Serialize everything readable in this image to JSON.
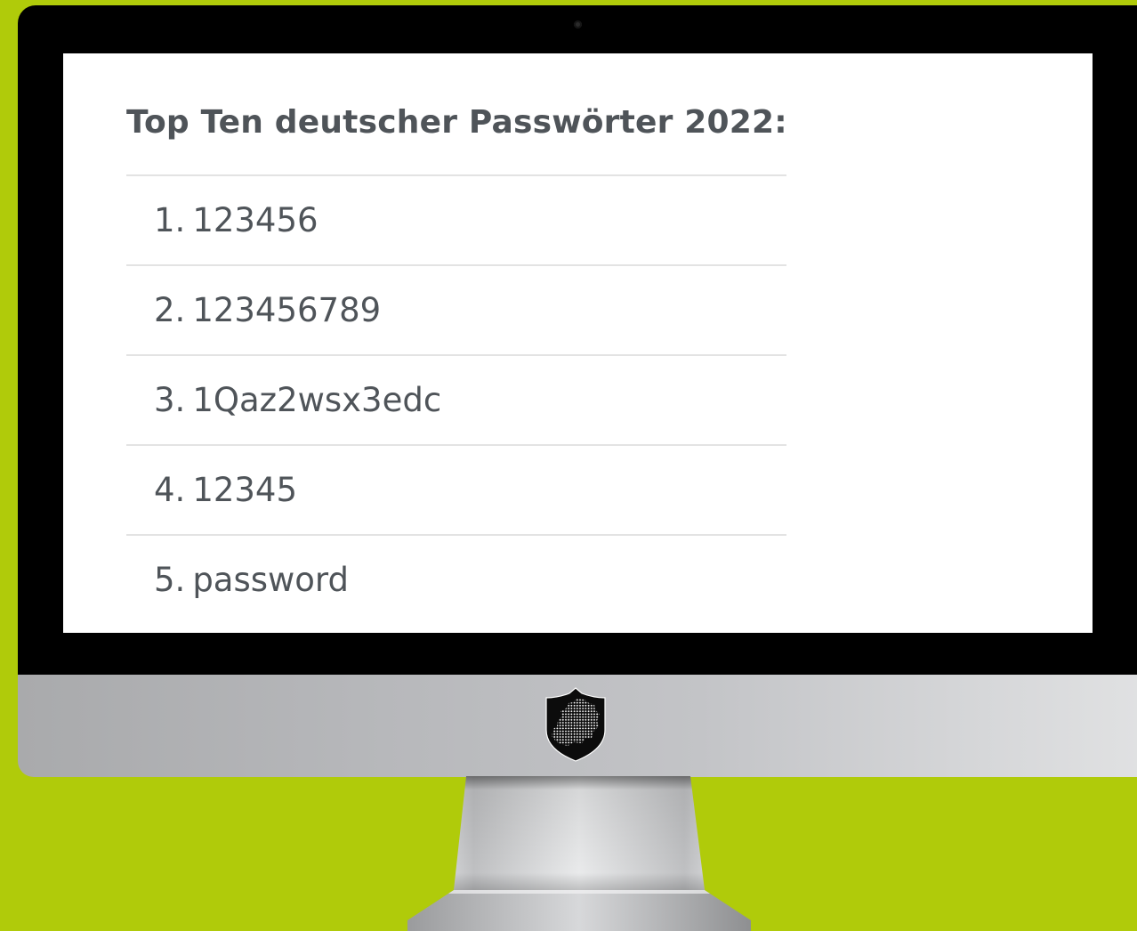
{
  "screen": {
    "title": "Top Ten deutscher Passwörter 2022:",
    "passwords": [
      {
        "rank": "1.",
        "value": "123456"
      },
      {
        "rank": "2.",
        "value": "123456789"
      },
      {
        "rank": "3.",
        "value": "1Qaz2wsx3edc"
      },
      {
        "rank": "4.",
        "value": "12345"
      },
      {
        "rank": "5.",
        "value": "password"
      }
    ]
  },
  "monitor": {
    "logo_icon": "shield-map-icon",
    "camera_icon": "camera-dot-icon"
  },
  "colors": {
    "background": "#b0cb0a",
    "bezel": "#000000",
    "screen": "#ffffff",
    "text": "#4f5459",
    "divider": "#e3e3e3"
  }
}
